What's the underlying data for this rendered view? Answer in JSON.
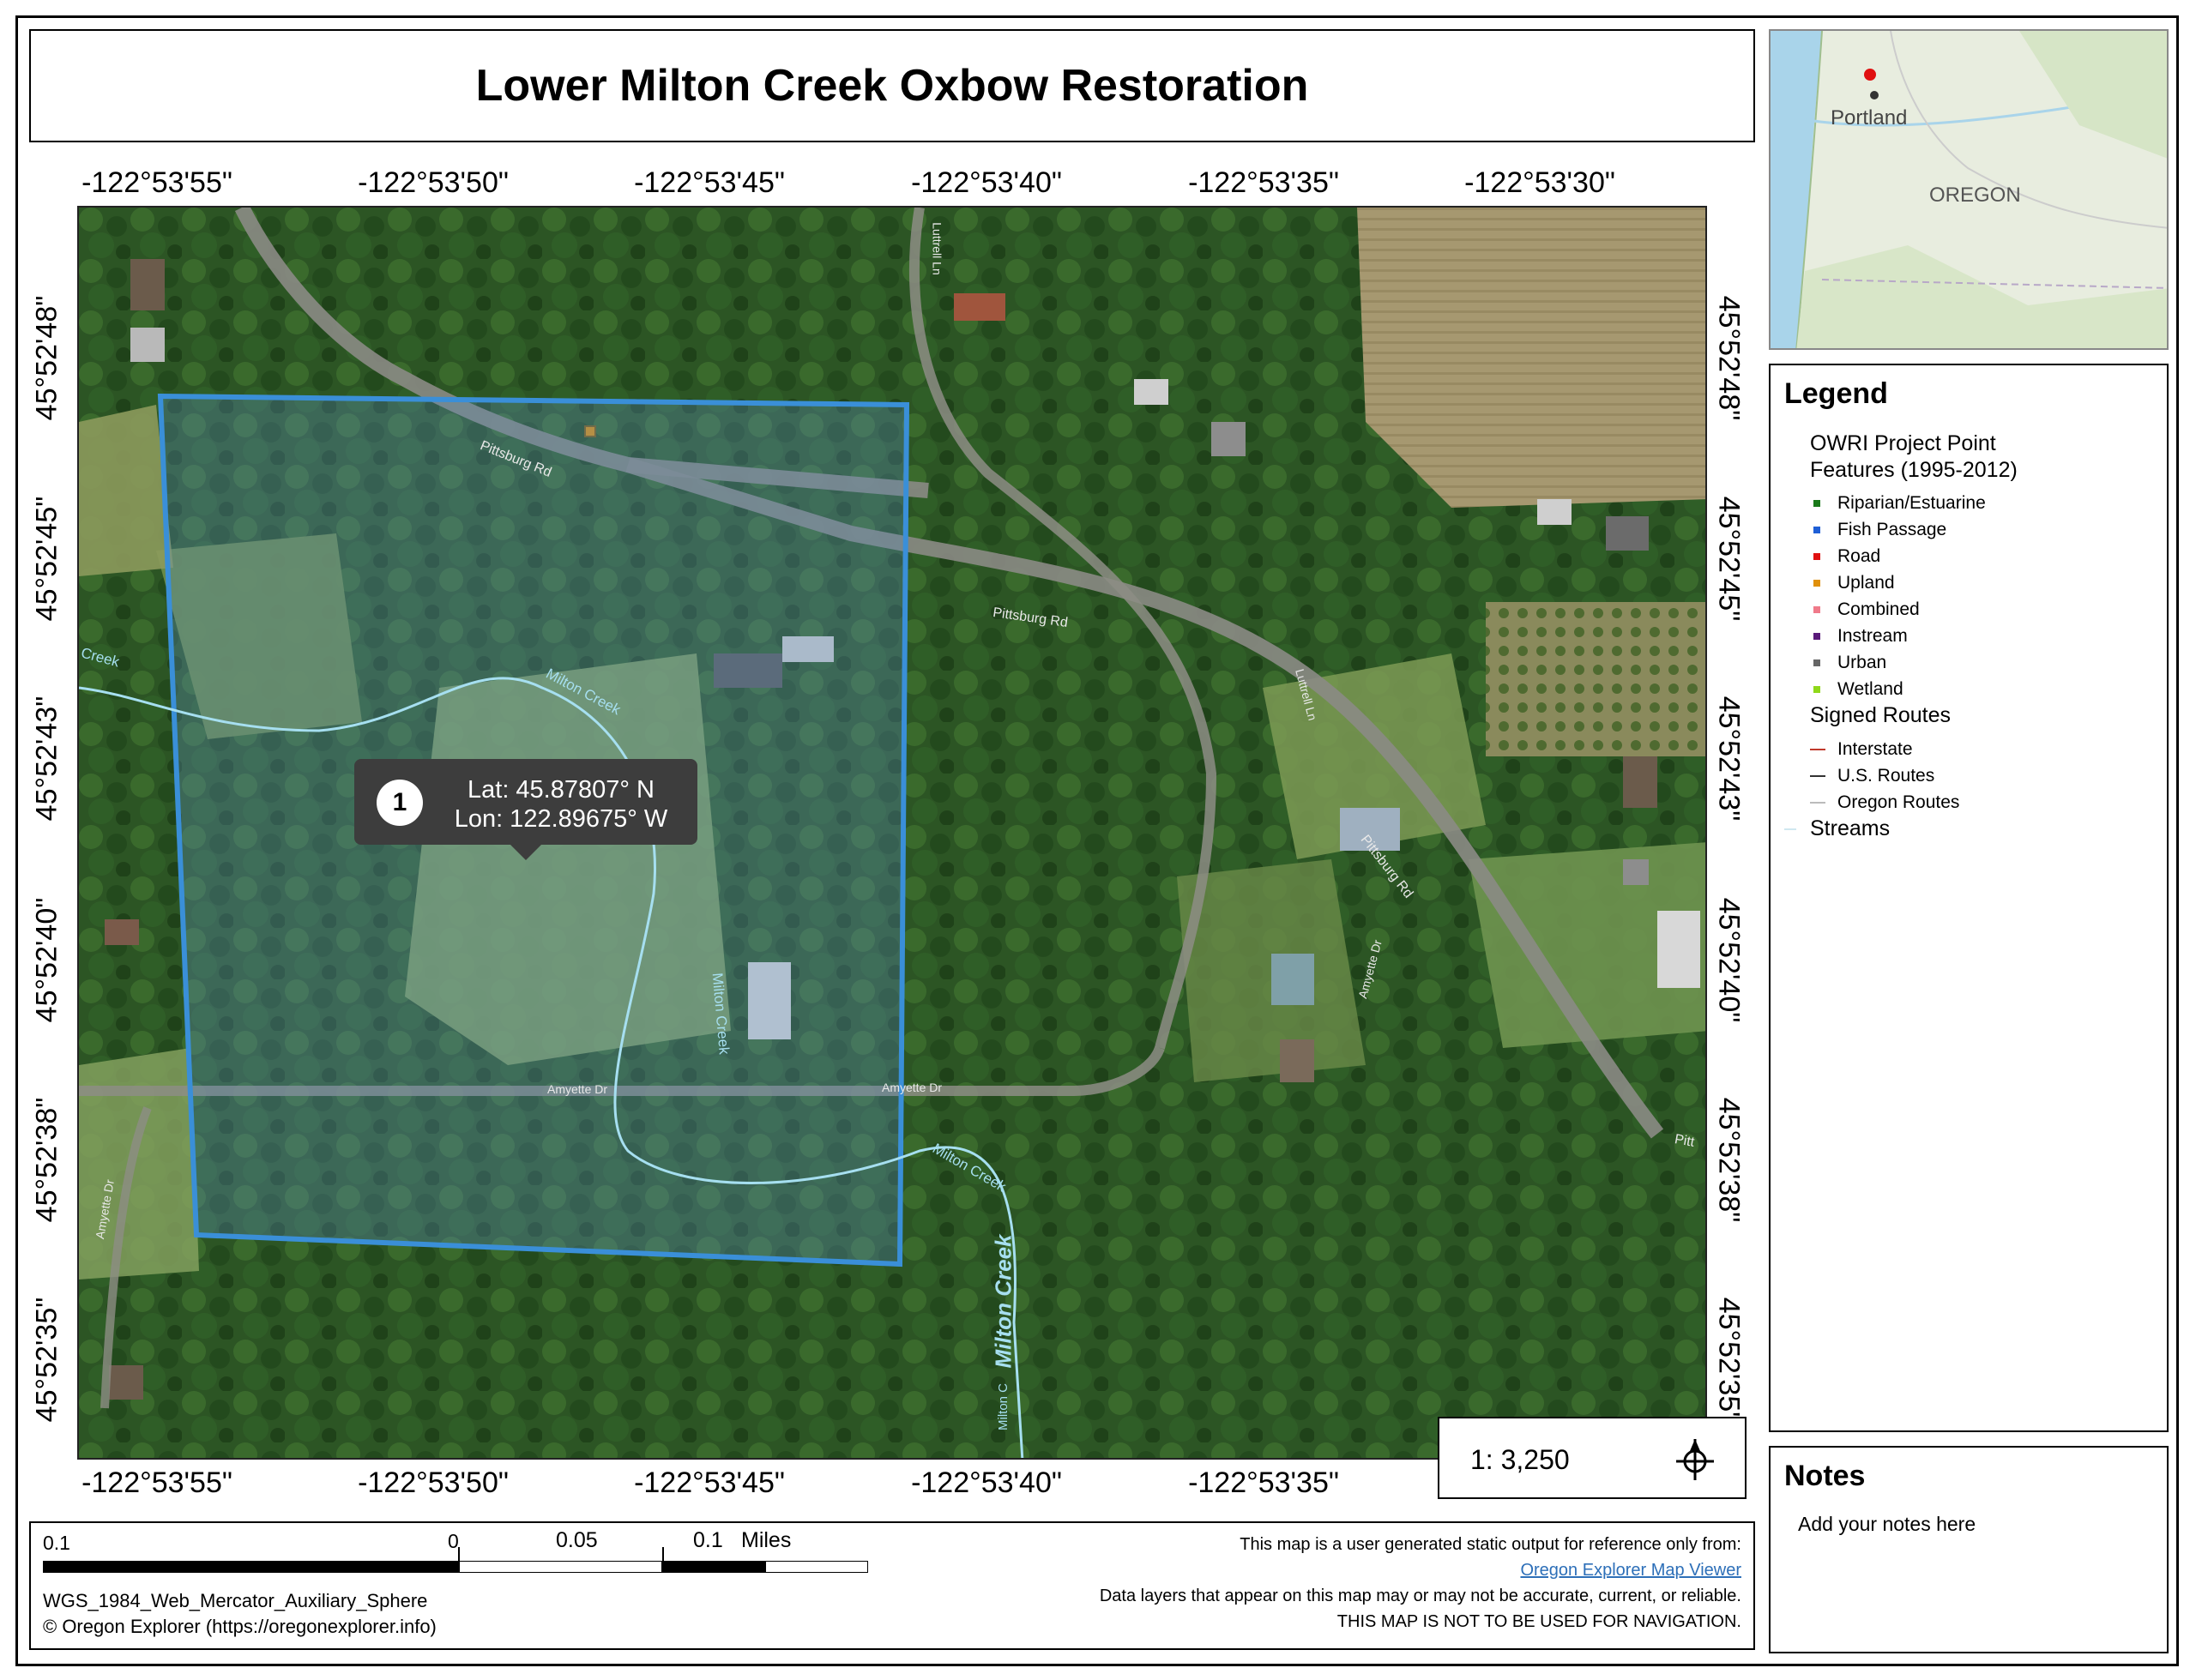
{
  "title": "Lower Milton Creek Oxbow Restoration",
  "longitudes": [
    "-122°53'55\"",
    "-122°53'50\"",
    "-122°53'45\"",
    "-122°53'40\"",
    "-122°53'35\"",
    "-122°53'30\""
  ],
  "latitudes": [
    "45°52'48\"",
    "45°52'45\"",
    "45°52'43\"",
    "45°52'40\"",
    "45°52'38\"",
    "45°52'35\""
  ],
  "inset": {
    "city": "Portland",
    "state": "OREGON"
  },
  "map_labels": {
    "pittsburg_rd_1": "Pittsburg Rd",
    "pittsburg_rd_2": "Pittsburg Rd",
    "pittsburg_rd_3": "Pittsburg Rd",
    "pittsburg_rd_4": "Pitt",
    "luttrell_ln_1": "Luttrell Ln",
    "luttrell_ln_2": "Luttrell Ln",
    "amyette_dr_1": "Amyette Dr",
    "amyette_dr_2": "Amyette Dr",
    "amyette_dr_3": "Amyette Dr",
    "amyette_dr_4": "Amyette Dr",
    "milton_creek_1": "Milton Creek",
    "milton_creek_2": "Milton Creek",
    "milton_creek_3": "Milton Creek",
    "milton_creek_4": "Milton Creek",
    "milton_creek_5": "Milton C",
    "creek_left": "Creek"
  },
  "popup": {
    "number": "1",
    "lat": "Lat: 45.87807° N",
    "lon": "Lon: 122.89675° W"
  },
  "legend": {
    "title": "Legend",
    "group1_title_line1": "OWRI Project Point",
    "group1_title_line2": "Features (1995-2012)",
    "group1_items": [
      {
        "label": "Riparian/Estuarine",
        "color": "#1a7a1a"
      },
      {
        "label": "Fish Passage",
        "color": "#1f5fd6"
      },
      {
        "label": "Road",
        "color": "#e01010"
      },
      {
        "label": "Upland",
        "color": "#e0900a"
      },
      {
        "label": "Combined",
        "color": "#f07a8a"
      },
      {
        "label": "Instream",
        "color": "#5a1a7a"
      },
      {
        "label": "Urban",
        "color": "#666666"
      },
      {
        "label": "Wetland",
        "color": "#8fd81a"
      }
    ],
    "group2_title": "Signed Routes",
    "group2_items": [
      {
        "label": "Interstate",
        "color": "#c0392b"
      },
      {
        "label": "U.S. Routes",
        "color": "#333333"
      },
      {
        "label": "Oregon Routes",
        "color": "#bbbbbb"
      }
    ],
    "streams_label": "Streams",
    "streams_color": "#d0e8f0"
  },
  "notes": {
    "title": "Notes",
    "text": "Add your notes here"
  },
  "scale": {
    "ratio": "1: 3,250"
  },
  "scalebar": {
    "label_left": "0.1",
    "label_zero": "0",
    "label_mid": "0.05",
    "label_right": "0.1",
    "units": "Miles"
  },
  "footer": {
    "projection": "WGS_1984_Web_Mercator_Auxiliary_Sphere",
    "copyright": "© Oregon Explorer (https://oregonexplorer.info)",
    "disclaimer1": "This map is a user generated static output for reference only from:",
    "link": "Oregon Explorer Map Viewer",
    "disclaimer2": "Data layers that appear on this map may or may not be accurate, current, or reliable.",
    "disclaimer3": "THIS MAP IS NOT TO BE USED FOR NAVIGATION."
  },
  "colors": {
    "project_area": "#3a8fd8",
    "stream": "#a6dff0",
    "forest": "#2f5a26",
    "field": "#7d9a5a",
    "popup_bg": "#3d3d3d"
  }
}
